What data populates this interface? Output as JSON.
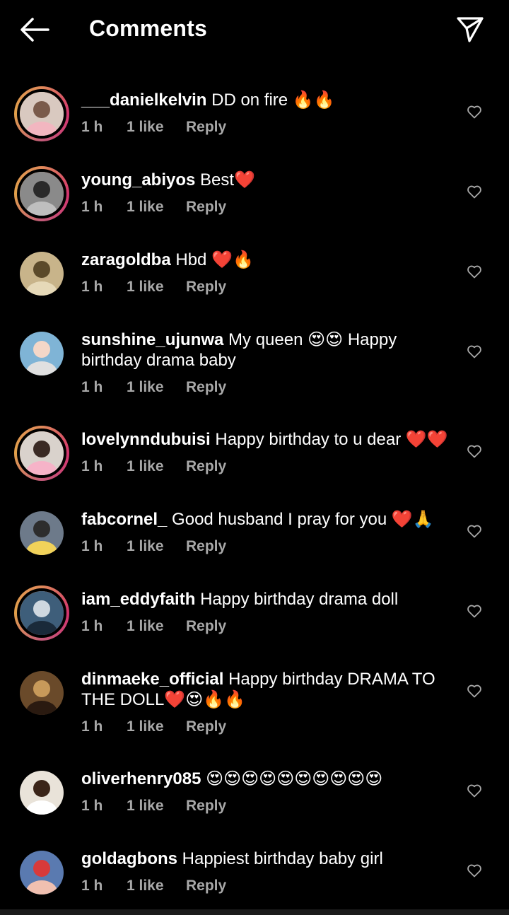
{
  "header": {
    "title": "Comments",
    "back_icon": "arrow-left-icon",
    "share_icon": "send-icon"
  },
  "colors": {
    "background": "#000000",
    "text": "#ffffff",
    "meta": "#a8a8a8",
    "story_ring": "#d3336e"
  },
  "comments": [
    {
      "username": "___danielkelvin",
      "text": "DD on fire 🔥🔥",
      "time": "1 h",
      "likes": "1 like",
      "reply": "Reply",
      "story_ring": true
    },
    {
      "username": "young_abiyos",
      "text": "Best❤️",
      "time": "1 h",
      "likes": "1 like",
      "reply": "Reply",
      "story_ring": true
    },
    {
      "username": "zaragoldba",
      "text": "Hbd ❤️🔥",
      "time": "1 h",
      "likes": "1 like",
      "reply": "Reply",
      "story_ring": false
    },
    {
      "username": "sunshine_ujunwa",
      "text": "My queen 😍😍 Happy birthday drama baby",
      "time": "1 h",
      "likes": "1 like",
      "reply": "Reply",
      "story_ring": false
    },
    {
      "username": "lovelynndubuisi",
      "text": "Happy birthday to u dear ❤️❤️",
      "time": "1 h",
      "likes": "1 like",
      "reply": "Reply",
      "story_ring": true
    },
    {
      "username": "fabcornel_",
      "text": "Good husband I pray for you ❤️🙏",
      "time": "1 h",
      "likes": "1 like",
      "reply": "Reply",
      "story_ring": false
    },
    {
      "username": "iam_eddyfaith",
      "text": "Happy birthday drama doll",
      "time": "1 h",
      "likes": "1 like",
      "reply": "Reply",
      "story_ring": true
    },
    {
      "username": "dinmaeke_official",
      "text": "Happy birthday DRAMA TO THE DOLL❤️😍🔥🔥",
      "time": "1 h",
      "likes": "1 like",
      "reply": "Reply",
      "story_ring": false
    },
    {
      "username": "oliverhenry085",
      "text": "😍😍😍😍😍😍😍😍😍😍",
      "time": "1 h",
      "likes": "1 like",
      "reply": "Reply",
      "story_ring": false
    },
    {
      "username": "goldagbons",
      "text": "Happiest birthday baby girl",
      "time": "1 h",
      "likes": "1 like",
      "reply": "Reply",
      "story_ring": false
    }
  ]
}
